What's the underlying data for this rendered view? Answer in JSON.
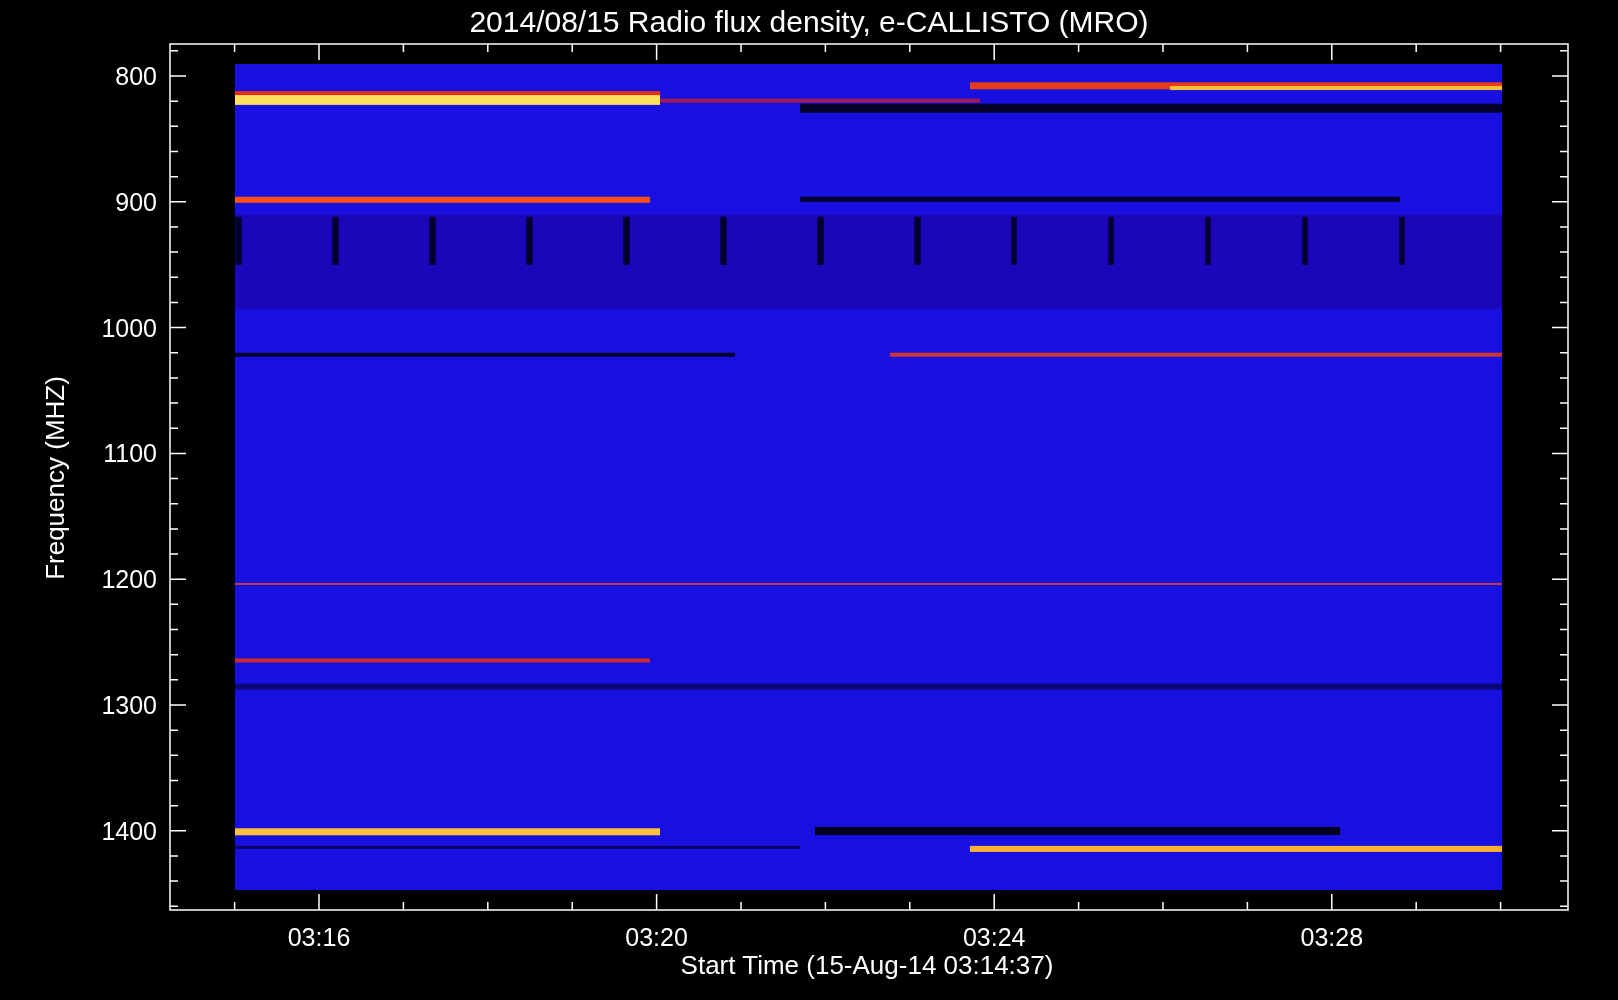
{
  "title": "2014/08/15  Radio flux density, e-CALLISTO (MRO)",
  "plot": {
    "ylabel": "Frequency (MHZ)",
    "xlabel": "Start Time (15-Aug-14 03:14:37)",
    "yticks": [
      "800",
      "900",
      "1000",
      "1100",
      "1200",
      "1300",
      "1400"
    ],
    "xticks": [
      "03:16",
      "03:20",
      "03:24",
      "03:28"
    ]
  }
}
